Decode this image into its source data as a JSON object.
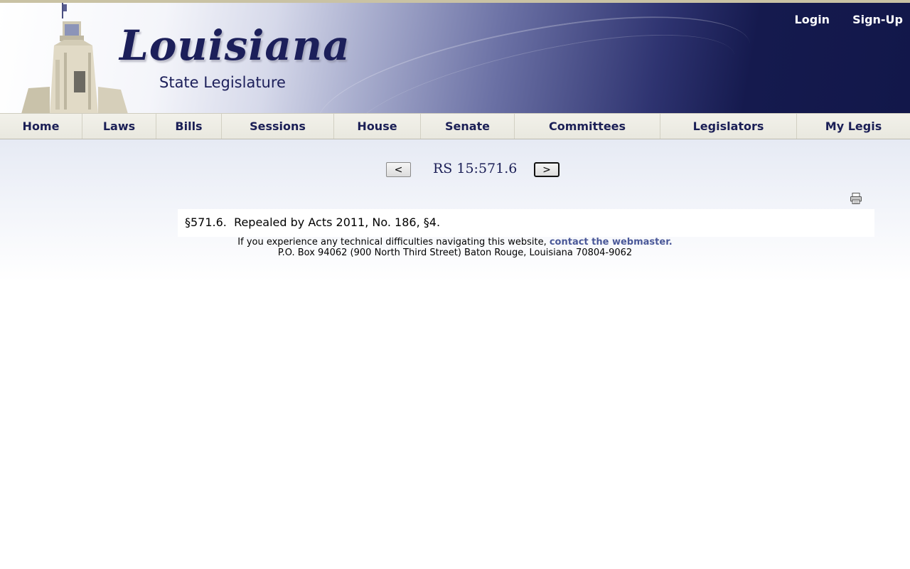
{
  "header": {
    "logo_main": "Louisiana",
    "logo_sub": "State Legislature",
    "login_label": "Login",
    "signup_label": "Sign-Up"
  },
  "nav": {
    "items": [
      {
        "label": "Home"
      },
      {
        "label": "Laws"
      },
      {
        "label": "Bills"
      },
      {
        "label": "Sessions"
      },
      {
        "label": "House"
      },
      {
        "label": "Senate"
      },
      {
        "label": "Committees"
      },
      {
        "label": "Legislators"
      },
      {
        "label": "My Legis"
      }
    ]
  },
  "section_nav": {
    "prev_label": "<",
    "title": "RS 15:571.6",
    "next_label": ">"
  },
  "content": {
    "text": "§571.6.  Repealed by Acts 2011, No. 186, §4."
  },
  "footer": {
    "line1_prefix": "If you experience any technical difficulties navigating this website, ",
    "line1_link": "contact the webmaster.",
    "line2": "P.O. Box 94062 (900 North Third Street) Baton Rouge, Louisiana 70804-9062"
  },
  "icons": {
    "print": "print-icon"
  },
  "colors": {
    "brand_navy": "#1b1f56",
    "header_dark": "#12174a",
    "link": "#4a5898"
  }
}
